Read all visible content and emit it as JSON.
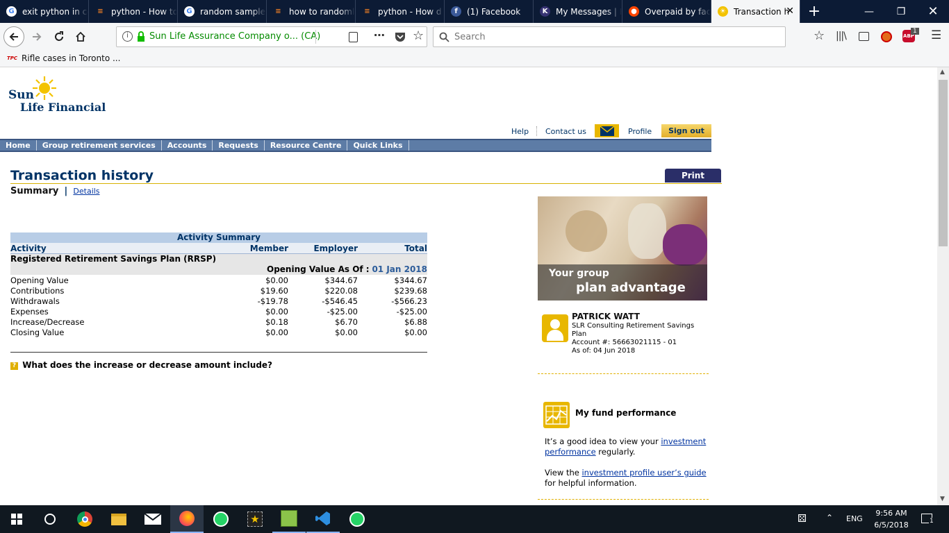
{
  "browser": {
    "tabs": [
      {
        "title": "exit python in cc",
        "icon": "google-icon",
        "color": "#ffffff"
      },
      {
        "title": "python - How to",
        "icon": "stackoverflow-icon",
        "color": "#f48024"
      },
      {
        "title": "random sample",
        "icon": "google-icon",
        "color": "#ffffff"
      },
      {
        "title": "how to randoml",
        "icon": "stackoverflow-icon",
        "color": "#f48024"
      },
      {
        "title": "python - How d",
        "icon": "stackoverflow-icon",
        "color": "#f48024"
      },
      {
        "title": "(1) Facebook",
        "icon": "facebook-icon",
        "color": "#3b5998"
      },
      {
        "title": "My Messages | K",
        "icon": "kijiji-icon",
        "color": "#373373"
      },
      {
        "title": "Overpaid by fact",
        "icon": "reddit-icon",
        "color": "#ff4500"
      },
      {
        "title": "Transaction h",
        "icon": "sunlife-icon",
        "color": "#f3c300",
        "active": true
      }
    ],
    "url_text": "Sun Life Assurance Company o... (CA)",
    "search_placeholder": "Search",
    "bookmark": "Rifle cases in Toronto ...",
    "bookmark_icon_text": "TPC",
    "addon_badge": "1",
    "addon_label": "ABP"
  },
  "site": {
    "logo_line1": "Sun",
    "logo_line2": "Life Financial",
    "util_links": [
      "Help",
      "Contact us",
      "Profile"
    ],
    "sign_out": "Sign out",
    "nav": [
      "Home",
      "Group retirement services",
      "Accounts",
      "Requests",
      "Resource Centre",
      "Quick Links"
    ]
  },
  "page": {
    "title": "Transaction history",
    "print_label": "Print",
    "summary_label": "Summary",
    "separator": "|",
    "details_link": "Details"
  },
  "activity": {
    "heading": "Activity Summary",
    "columns": [
      "Activity",
      "Member",
      "Employer",
      "Total"
    ],
    "plan": "Registered Retirement Savings Plan (RRSP)",
    "opening_label": "Opening Value As Of :",
    "opening_date": "01 Jan 2018",
    "rows": [
      {
        "label": "Opening Value",
        "member": "$0.00",
        "employer": "$344.67",
        "total": "$344.67"
      },
      {
        "label": "Contributions",
        "member": "$19.60",
        "employer": "$220.08",
        "total": "$239.68"
      },
      {
        "label": "Withdrawals",
        "member": "-$19.78",
        "employer": "-$546.45",
        "total": "-$566.23"
      },
      {
        "label": "Expenses",
        "member": "$0.00",
        "employer": "-$25.00",
        "total": "-$25.00"
      },
      {
        "label": "Increase/Decrease",
        "member": "$0.18",
        "employer": "$6.70",
        "total": "$6.88"
      },
      {
        "label": "Closing Value",
        "member": "$0.00",
        "employer": "$0.00",
        "total": "$0.00"
      }
    ],
    "faq": "What does the increase or decrease amount include?"
  },
  "sidebar": {
    "banner_line1": "Your group",
    "banner_line2": "plan advantage",
    "name": "PATRICK WATT",
    "plan": "SLR Consulting Retirement Savings Plan",
    "account": "Account #: 56663021115 - 01",
    "as_of": "As of: 04 Jun 2018",
    "fund_title": "My fund performance",
    "fund_p1_pre": "It’s a good idea to view your ",
    "fund_p1_link": "investment performance",
    "fund_p1_post": " regularly.",
    "fund_p2_pre": "View the ",
    "fund_p2_link": "investment profile user’s guide",
    "fund_p2_post": " for helpful information."
  },
  "taskbar": {
    "lang": "ENG",
    "time": "9:56 AM",
    "date": "6/5/2018",
    "notif_count": "1"
  },
  "colors": {
    "brand_blue": "#003366",
    "nav_blue": "#5d7ca6",
    "sunlife_yellow": "#f3c300",
    "table_header_bg": "#b8cde6"
  }
}
